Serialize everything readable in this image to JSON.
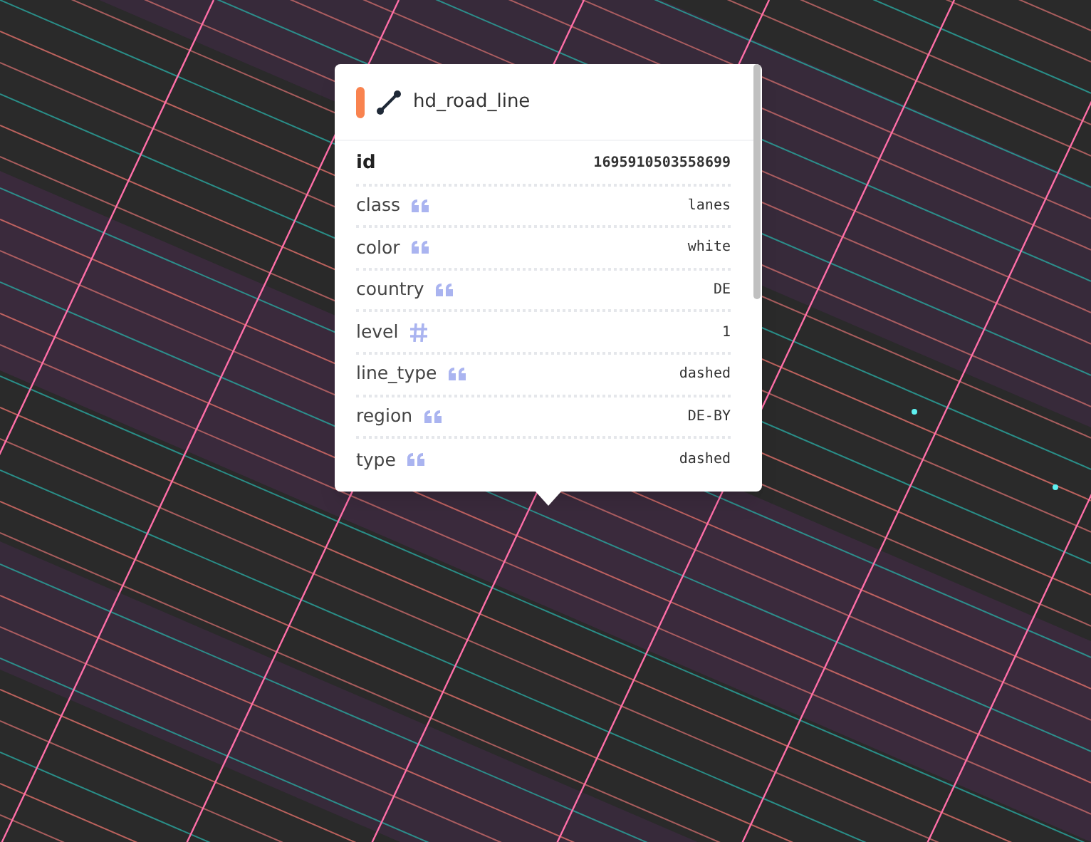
{
  "popup": {
    "color": "#f9834f",
    "title": "hd_road_line",
    "properties": [
      {
        "kind": "id",
        "key": "id",
        "value": "1695910503558699"
      },
      {
        "kind": "string",
        "key": "class",
        "value": "lanes"
      },
      {
        "kind": "string",
        "key": "color",
        "value": "white"
      },
      {
        "kind": "string",
        "key": "country",
        "value": "DE"
      },
      {
        "kind": "number",
        "key": "level",
        "value": "1"
      },
      {
        "kind": "string",
        "key": "line_type",
        "value": "dashed"
      },
      {
        "kind": "string",
        "key": "region",
        "value": "DE-BY"
      },
      {
        "kind": "string",
        "key": "type",
        "value": "dashed"
      }
    ]
  }
}
